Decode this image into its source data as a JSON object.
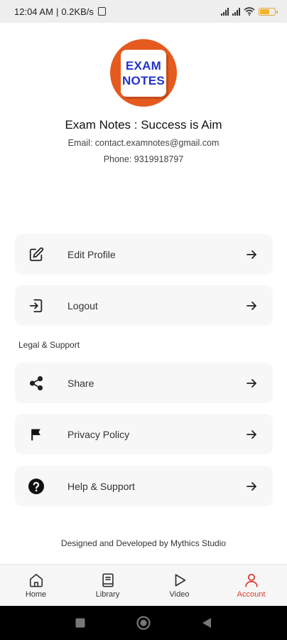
{
  "status_bar": {
    "time": "12:04 AM",
    "speed": "0.2KB/s",
    "battery_level": 0.6,
    "battery_color": "#f0b429"
  },
  "profile": {
    "logo_line1": "EXAM",
    "logo_line2": "NOTES",
    "logo_bg_color": "#e55a1f",
    "logo_text_color": "#2333c9",
    "name": "Exam Notes : Success is Aim",
    "email": "Email: contact.examnotes@gmail.com",
    "phone": "Phone: 9319918797"
  },
  "menu": {
    "edit_profile": {
      "label": "Edit Profile",
      "icon": "edit-icon"
    },
    "logout": {
      "label": "Logout",
      "icon": "logout-icon"
    },
    "section_label": "Legal & Support",
    "share": {
      "label": "Share",
      "icon": "share-icon"
    },
    "privacy_policy": {
      "label": "Privacy Policy",
      "icon": "flag-icon"
    },
    "help_support": {
      "label": "Help & Support",
      "icon": "help-icon"
    }
  },
  "footer": {
    "credit": "Designed and Developed by Mythics Studio"
  },
  "bottom_nav": {
    "active_color": "#e0392f",
    "items": [
      {
        "label": "Home",
        "icon": "home-icon",
        "active": false
      },
      {
        "label": "Library",
        "icon": "library-icon",
        "active": false
      },
      {
        "label": "Video",
        "icon": "play-icon",
        "active": false
      },
      {
        "label": "Account",
        "icon": "user-icon",
        "active": true
      }
    ]
  }
}
